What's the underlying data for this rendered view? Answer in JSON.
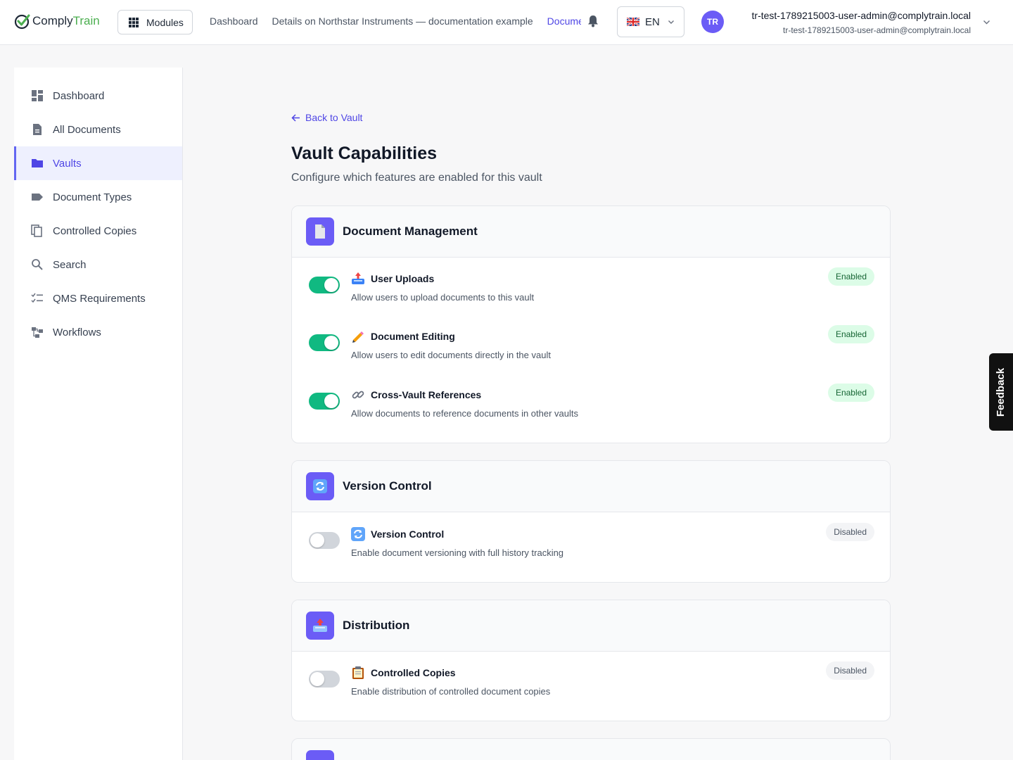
{
  "header": {
    "logo_part1": "Comply",
    "logo_part2": "Train",
    "modules_label": "Modules",
    "breadcrumbs": [
      "Dashboard",
      "Details on Northstar Instruments — documentation example",
      "Documents"
    ],
    "language": "EN",
    "avatar_initials": "TR",
    "user_name": "tr-test-1789215003-user-admin@complytrain.local",
    "user_email": "tr-test-1789215003-user-admin@complytrain.local"
  },
  "sidebar": {
    "items": [
      {
        "label": "Dashboard",
        "icon": "dashboard-icon"
      },
      {
        "label": "All Documents",
        "icon": "document-icon"
      },
      {
        "label": "Vaults",
        "icon": "folder-icon",
        "active": true
      },
      {
        "label": "Document Types",
        "icon": "tag-icon"
      },
      {
        "label": "Controlled Copies",
        "icon": "copy-icon"
      },
      {
        "label": "Search",
        "icon": "search-icon"
      },
      {
        "label": "QMS Requirements",
        "icon": "checklist-icon"
      },
      {
        "label": "Workflows",
        "icon": "workflow-icon"
      }
    ]
  },
  "main": {
    "back_label": "Back to Vault",
    "title": "Vault Capabilities",
    "subtitle": "Configure which features are enabled for this vault",
    "sections": [
      {
        "title": "Document Management",
        "icon": "document-icon",
        "capabilities": [
          {
            "name": "User Uploads",
            "desc": "Allow users to upload documents to this vault",
            "enabled": true,
            "status": "Enabled",
            "icon": "inbox-tray-icon"
          },
          {
            "name": "Document Editing",
            "desc": "Allow users to edit documents directly in the vault",
            "enabled": true,
            "status": "Enabled",
            "icon": "pencil-icon"
          },
          {
            "name": "Cross-Vault References",
            "desc": "Allow documents to reference documents in other vaults",
            "enabled": true,
            "status": "Enabled",
            "icon": "link-icon"
          }
        ]
      },
      {
        "title": "Version Control",
        "icon": "refresh-icon",
        "capabilities": [
          {
            "name": "Version Control",
            "desc": "Enable document versioning with full history tracking",
            "enabled": false,
            "status": "Disabled",
            "icon": "refresh-icon"
          }
        ]
      },
      {
        "title": "Distribution",
        "icon": "inbox-tray-icon",
        "capabilities": [
          {
            "name": "Controlled Copies",
            "desc": "Enable distribution of controlled document copies",
            "enabled": false,
            "status": "Disabled",
            "icon": "clipboard-icon"
          }
        ]
      }
    ]
  },
  "feedback_label": "Feedback",
  "colors": {
    "accent": "#4f46e5",
    "toggle_on": "#10b981",
    "toggle_off": "#d1d5db",
    "enabled_badge_bg": "#dcfce7",
    "enabled_badge_text": "#166534",
    "section_icon_bg": "#6b5cf6"
  }
}
